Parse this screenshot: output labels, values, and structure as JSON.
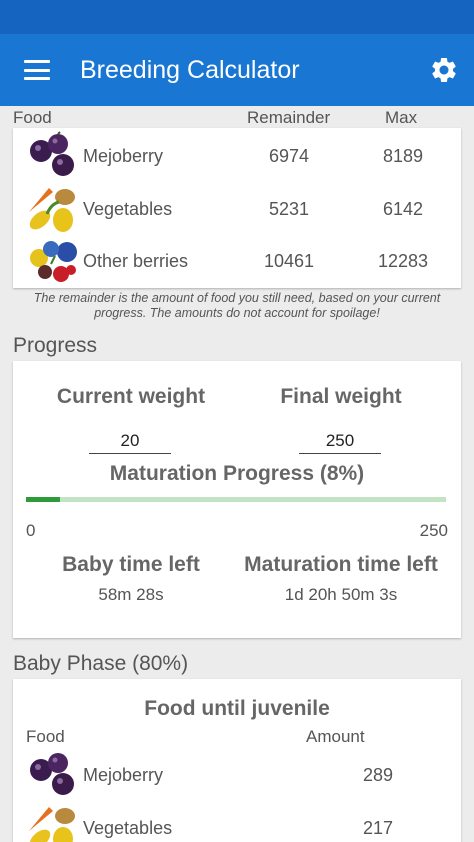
{
  "app": {
    "title": "Breeding Calculator"
  },
  "food_table": {
    "headers": {
      "food": "Food",
      "remainder": "Remainder",
      "max": "Max"
    },
    "rows": [
      {
        "name": "Mejoberry",
        "remainder": "6974",
        "max": "8189",
        "icon": "mejoberry-icon"
      },
      {
        "name": "Vegetables",
        "remainder": "5231",
        "max": "6142",
        "icon": "vegetables-icon"
      },
      {
        "name": "Other berries",
        "remainder": "10461",
        "max": "12283",
        "icon": "berries-icon"
      }
    ],
    "note": "The remainder is the amount of food you still need, based on your current progress. The amounts do not account for spoilage!"
  },
  "progress": {
    "section_title": "Progress",
    "current_weight_label": "Current weight",
    "current_weight_value": "20",
    "final_weight_label": "Final weight",
    "final_weight_value": "250",
    "maturation_label": "Maturation Progress (8%)",
    "maturation_fraction": 0.08,
    "range_min": "0",
    "range_max": "250",
    "baby_time_label": "Baby time left",
    "baby_time_value": "58m 28s",
    "maturation_time_label": "Maturation time left",
    "maturation_time_value": "1d 20h 50m 3s"
  },
  "baby_phase": {
    "section_title": "Baby Phase (80%)",
    "card_title": "Food until juvenile",
    "headers": {
      "food": "Food",
      "amount": "Amount"
    },
    "rows": [
      {
        "name": "Mejoberry",
        "amount": "289",
        "icon": "mejoberry-icon"
      },
      {
        "name": "Vegetables",
        "amount": "217",
        "icon": "vegetables-icon"
      }
    ]
  },
  "colors": {
    "app_bar": "#1976d2",
    "status_bar": "#1565c0",
    "progress_fill": "#2e9b3a",
    "progress_track": "#c3e3c5"
  }
}
